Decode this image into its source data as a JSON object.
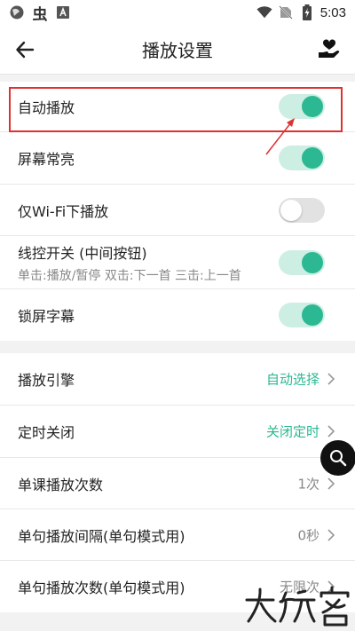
{
  "status_bar": {
    "time": "5:03",
    "char_icon": "虫",
    "icons": [
      "globe-icon",
      "bug-icon",
      "text-a-icon",
      "wifi-icon",
      "no-sim-icon",
      "battery-charging-icon"
    ]
  },
  "app_bar": {
    "title": "播放设置",
    "back_icon": "arrow-left-icon",
    "favorite_icon": "hand-heart-icon"
  },
  "settings_toggles": [
    {
      "label": "自动播放",
      "on": true
    },
    {
      "label": "屏幕常亮",
      "on": true
    },
    {
      "label": "仅Wi-Fi下播放",
      "on": false
    },
    {
      "label": "线控开关 (中间按钮)",
      "sublabel": "单击:播放/暂停 双击:下一首 三击:上一首",
      "on": true
    },
    {
      "label": "锁屏字幕",
      "on": true
    }
  ],
  "settings_selects": [
    {
      "label": "播放引擎",
      "value": "自动选择"
    },
    {
      "label": "定时关闭",
      "value": "关闭定时"
    },
    {
      "label": "单课播放次数",
      "value": "1次"
    },
    {
      "label": "单句播放间隔(单句模式用)",
      "value": "0秒"
    },
    {
      "label": "单句播放次数(单句模式用)",
      "value": "无限次"
    }
  ],
  "colors": {
    "accent": "#2bb893",
    "toggle_track_on": "#cdeee3",
    "highlight": "#e03131",
    "background": "#f2f2f2"
  },
  "watermark": {
    "text": "大玩家"
  }
}
